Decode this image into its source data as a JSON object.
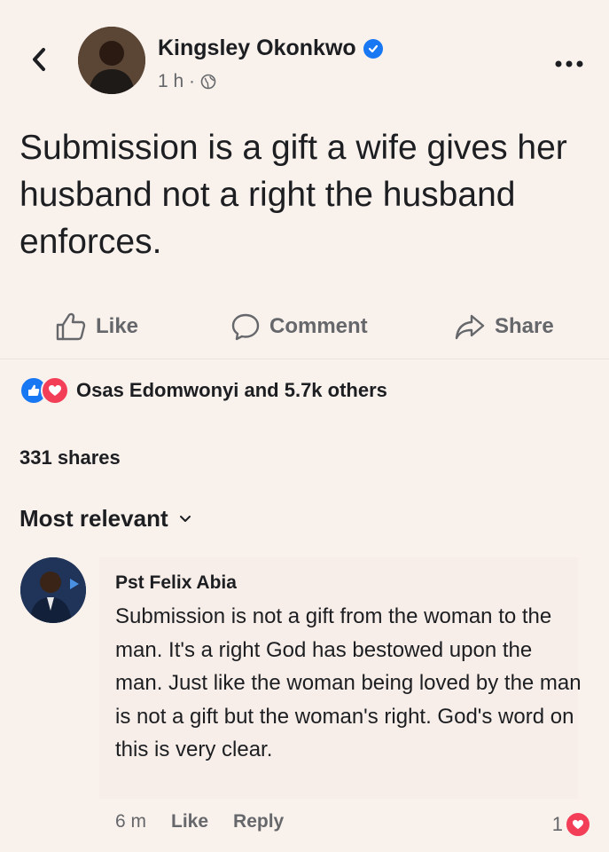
{
  "post": {
    "author": "Kingsley Okonkwo",
    "time": "1 h ·",
    "text": "Submission is a gift a wife gives her husband not a right the husband enforces."
  },
  "actions": {
    "like": "Like",
    "comment": "Comment",
    "share": "Share"
  },
  "reactions": {
    "text": "Osas Edomwonyi and 5.7k others"
  },
  "shares": "331 shares",
  "sort_label": "Most relevant",
  "comment": {
    "author": "Pst Felix Abia",
    "text": "Submission is not a gift from the woman to the man. It's a right God has bestowed upon the man. Just like the woman being loved by the man is not a gift but the woman's right. God's word on this is very clear.",
    "time": "6 m",
    "like": "Like",
    "reply": "Reply",
    "reaction_count": "1"
  },
  "colors": {
    "facebook_blue": "#1877f2",
    "love_red": "#f33e58",
    "muted": "#65676b",
    "background": "#f9f1ec"
  },
  "icons": [
    "back-arrow-icon",
    "verified-badge-icon",
    "globe-icon",
    "more-icon",
    "like-icon",
    "comment-icon",
    "share-icon",
    "like-reaction-icon",
    "love-reaction-icon",
    "chevron-down-icon"
  ]
}
